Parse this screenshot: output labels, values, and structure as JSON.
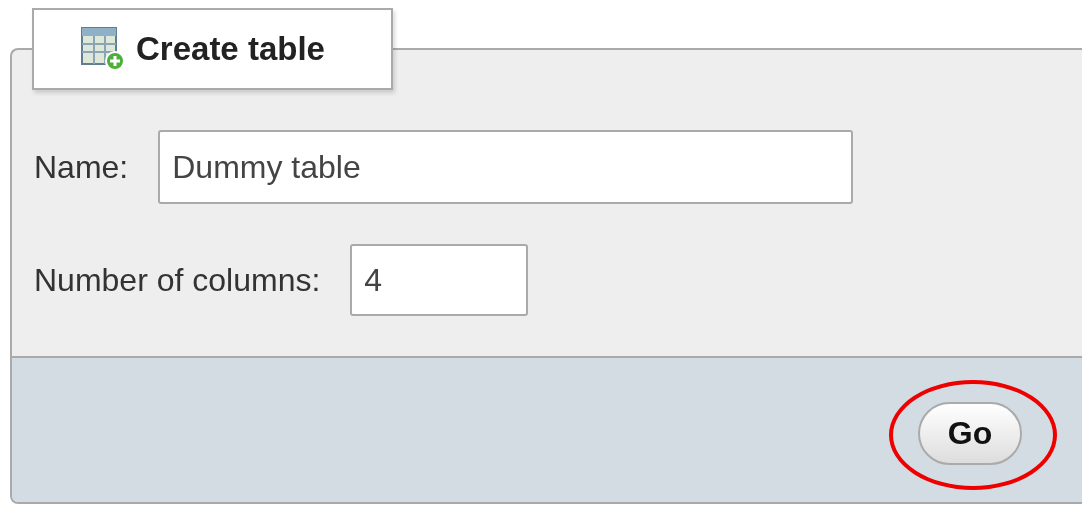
{
  "tab": {
    "label": "Create table"
  },
  "fields": [
    {
      "label": "Name:",
      "value": "Dummy table",
      "kind": "text"
    },
    {
      "label": "Number of columns:",
      "value": "4",
      "kind": "number"
    }
  ],
  "button": {
    "label": "Go",
    "highlighted": true
  }
}
